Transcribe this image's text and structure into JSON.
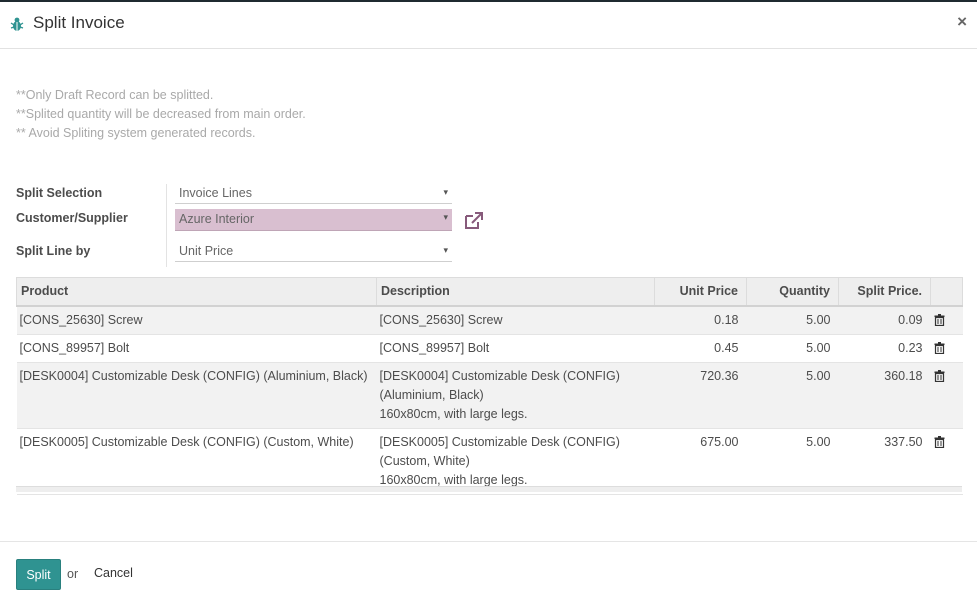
{
  "modal": {
    "title": "Split Invoice",
    "close_label": "×"
  },
  "notes": [
    "**Only Draft Record can be splitted.",
    "**Splited quantity will be decreased from main order.",
    "** Avoid Spliting system generated records."
  ],
  "form": {
    "split_selection": {
      "label": "Split Selection",
      "value": "Invoice Lines"
    },
    "customer_supplier": {
      "label": "Customer/Supplier",
      "value": "Azure Interior"
    },
    "split_line_by": {
      "label": "Split Line by",
      "value": "Unit Price"
    },
    "caret": "▾"
  },
  "table": {
    "headers": [
      "Product",
      "Description",
      "Unit Price",
      "Quantity",
      "Split Price."
    ],
    "rows": [
      {
        "product": "[CONS_25630] Screw",
        "description": [
          "[CONS_25630] Screw"
        ],
        "unit_price": "0.18",
        "quantity": "5.00",
        "split_price": "0.09"
      },
      {
        "product": "[CONS_89957] Bolt",
        "description": [
          "[CONS_89957] Bolt"
        ],
        "unit_price": "0.45",
        "quantity": "5.00",
        "split_price": "0.23"
      },
      {
        "product": "[DESK0004] Customizable Desk (CONFIG) (Aluminium, Black)",
        "description": [
          "[DESK0004] Customizable Desk (CONFIG)",
          "(Aluminium, Black)",
          "160x80cm, with large legs."
        ],
        "unit_price": "720.36",
        "quantity": "5.00",
        "split_price": "360.18"
      },
      {
        "product": "[DESK0005] Customizable Desk (CONFIG) (Custom, White)",
        "description": [
          "[DESK0005] Customizable Desk (CONFIG)",
          "(Custom, White)",
          "160x80cm, with large legs."
        ],
        "unit_price": "675.00",
        "quantity": "5.00",
        "split_price": "337.50"
      }
    ]
  },
  "footer": {
    "split_label": "Split",
    "or_label": "or",
    "cancel_label": "Cancel"
  },
  "icons": {
    "title_icon": "bug-icon",
    "external_link": "external-link-icon",
    "row_delete": "trash-icon"
  },
  "colors": {
    "primary": "#2f9391",
    "highlight_field": "#d9bfd0",
    "link_icon": "#875a7b",
    "note_text": "#a9a9a9"
  }
}
